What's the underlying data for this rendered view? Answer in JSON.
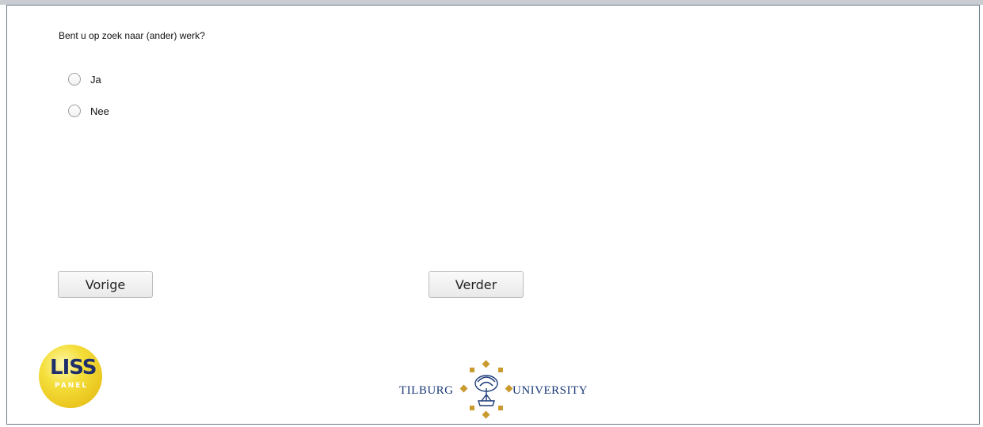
{
  "question": {
    "text": "Bent u op zoek naar (ander) werk?"
  },
  "options": [
    {
      "label": "Ja"
    },
    {
      "label": "Nee"
    }
  ],
  "buttons": {
    "previous_label": "Vorige",
    "next_label": "Verder"
  },
  "logos": {
    "liss_word": "LISS",
    "liss_subword": "PANEL",
    "tilburg_left": "TILBURG",
    "tilburg_right": "UNIVERSITY"
  },
  "colors": {
    "frame_border": "#6d7a86",
    "top_bar": "#c9cdd1",
    "liss_yellow": "#f5df3c",
    "tilburg_blue": "#1b3a78",
    "tilburg_gold": "#c99a2e"
  }
}
